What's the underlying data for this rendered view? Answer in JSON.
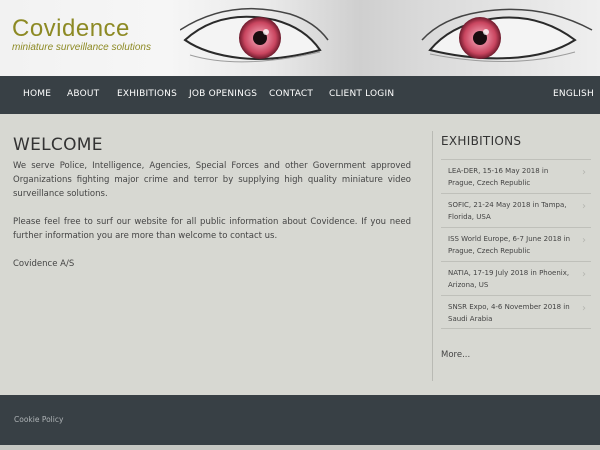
{
  "header": {
    "logo_text": "Covidence",
    "tagline": "miniature surveillance solutions"
  },
  "nav": {
    "items": [
      "HOME",
      "ABOUT",
      "EXHIBITIONS",
      "JOB OPENINGS",
      "CONTACT",
      "CLIENT LOGIN"
    ],
    "language": "ENGLISH"
  },
  "main": {
    "title": "WELCOME",
    "paragraphs": [
      "We serve Police, Intelligence, Agencies, Special Forces and other Government approved Organizations fighting major crime and terror by supplying high quality miniature video surveillance solutions.",
      "Please feel free to surf our website for all public information about Covidence. If you need further information you are more than welcome to contact us.",
      "Covidence A/S"
    ]
  },
  "sidebar": {
    "title": "EXHIBITIONS",
    "items": [
      "LEA-DER, 15-16 May 2018 in Prague, Czech Republic",
      "SOFIC, 21-24 May 2018 in Tampa, Florida, USA",
      "ISS World Europe, 6-7 June 2018 in Prague, Czech Republic",
      "NATIA, 17-19 July 2018 in Phoenix, Arizona, US",
      "SNSR Expo, 4-6 November 2018 in Saudi Arabia"
    ],
    "more": "More..."
  },
  "footer": {
    "cookie": "Cookie Policy"
  },
  "colors": {
    "nav_bg": "#384045",
    "page_bg": "#d7d8d2",
    "brand": "#8d8a24",
    "eye_iris": "#d2536b"
  },
  "icons": {
    "chevron": "chevron-right-icon"
  }
}
